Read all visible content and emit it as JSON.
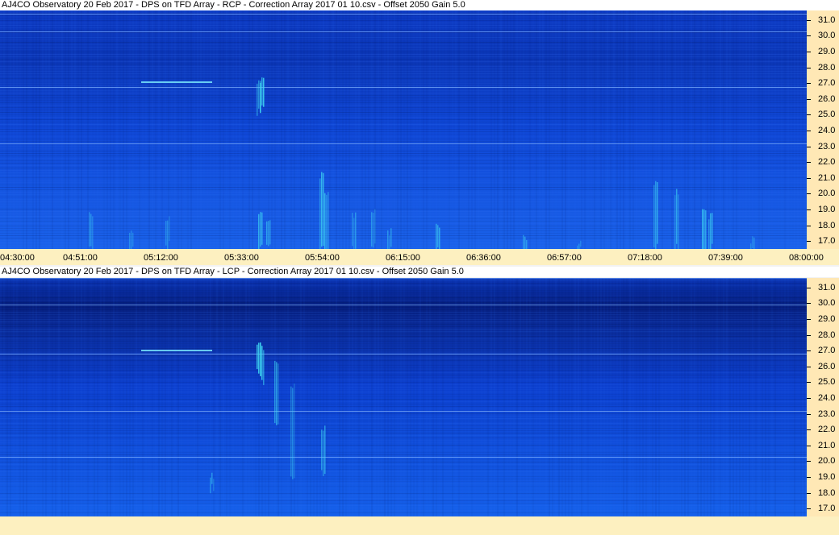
{
  "colors": {
    "background_base": "#0e3fd6",
    "background_dark": "#082a9a",
    "burst": "#33d6f0",
    "axis_bg": "#ffe8b5",
    "timebar_bg": "#fdf0c0"
  },
  "panels": [
    {
      "id": "rcp",
      "title": "AJ4CO Observatory 20 Feb 2017  -  DPS on TFD Array  -  RCP  -  Correction Array 2017 01 10.csv  -  Offset 2050  Gain 5.0"
    },
    {
      "id": "lcp",
      "title": "AJ4CO Observatory 20 Feb 2017  -  DPS on TFD Array  -  LCP  -  Correction Array 2017 01 10.csv  -  Offset 2050  Gain 5.0"
    }
  ],
  "chart_data": {
    "type": "heatmap",
    "ylabel": "",
    "xlabel": "",
    "y_ticks": [
      "31.0",
      "30.0",
      "29.0",
      "28.0",
      "27.0",
      "26.0",
      "25.0",
      "24.0",
      "23.0",
      "22.0",
      "21.0",
      "20.0",
      "19.0",
      "18.0",
      "17.0"
    ],
    "y_range": [
      16.5,
      31.6
    ],
    "x_ticks": [
      "04:30:00",
      "04:51:00",
      "05:12:00",
      "05:33:00",
      "05:54:00",
      "06:15:00",
      "06:36:00",
      "06:57:00",
      "07:18:00",
      "07:39:00",
      "08:00:00"
    ],
    "x_range": [
      "04:30:00",
      "08:00:00"
    ],
    "grid": false
  }
}
